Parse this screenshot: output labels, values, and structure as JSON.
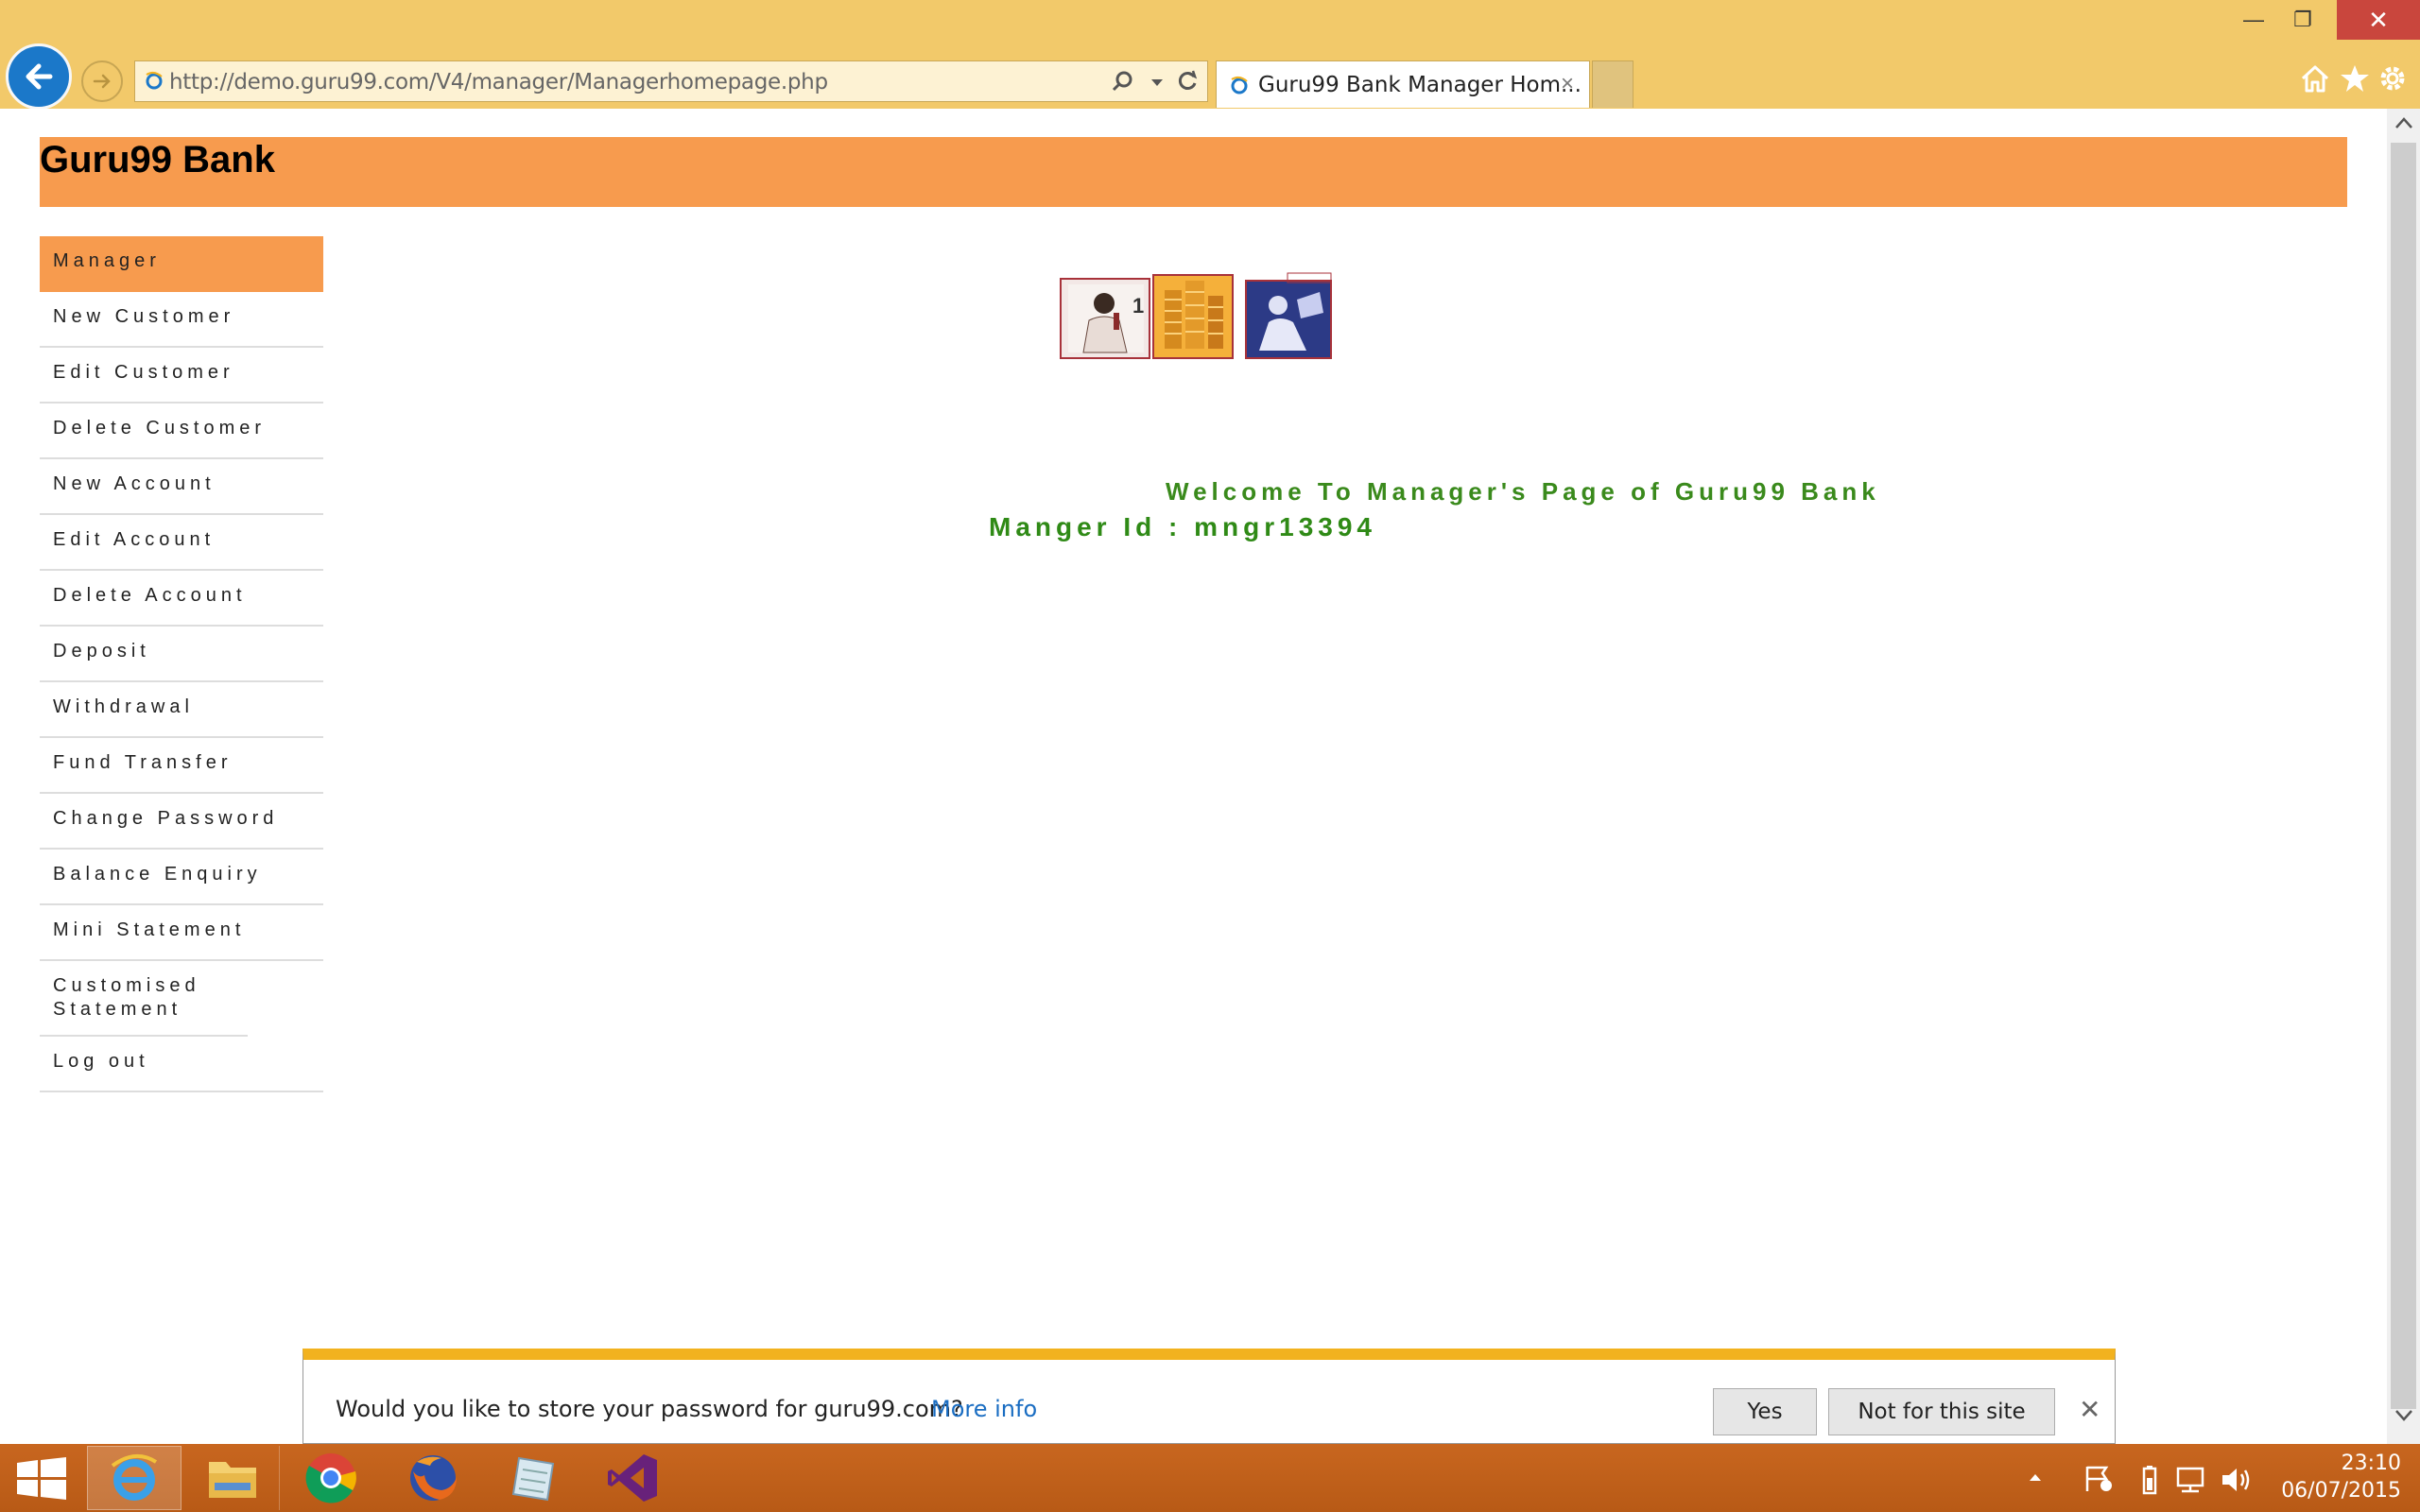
{
  "browser": {
    "address_url": "http://demo.guru99.com/V4/manager/Managerhomepage.php",
    "tab_title": "Guru99 Bank Manager Hom...",
    "tab_close_glyph": "×",
    "window_controls": {
      "minimize": "—",
      "restore": "❐",
      "close": "✕"
    }
  },
  "site": {
    "title": "Guru99 Bank",
    "welcome_text": "Welcome To Manager's Page of Guru99 Bank",
    "manager_id_text": "Manger Id : mngr13394"
  },
  "menu": {
    "items": [
      {
        "label": "Manager",
        "active": true
      },
      {
        "label": "New Customer"
      },
      {
        "label": "Edit Customer"
      },
      {
        "label": "Delete Customer"
      },
      {
        "label": "New Account"
      },
      {
        "label": "Edit Account"
      },
      {
        "label": "Delete Account"
      },
      {
        "label": "Deposit"
      },
      {
        "label": "Withdrawal"
      },
      {
        "label": "Fund Transfer"
      },
      {
        "label": "Change Password"
      },
      {
        "label": "Balance Enquiry"
      },
      {
        "label": "Mini Statement"
      },
      {
        "label": "Customised Statement"
      },
      {
        "label": "Log out"
      }
    ]
  },
  "notification": {
    "message": "Would you like to store your password for guru99.com?",
    "more_info": "More info",
    "yes": "Yes",
    "not_for_site": "Not for this site",
    "close_glyph": "✕"
  },
  "taskbar": {
    "time": "23:10",
    "date": "06/07/2015",
    "apps": [
      "internet-explorer",
      "file-explorer",
      "chrome",
      "firefox",
      "notes",
      "visual-studio"
    ]
  },
  "colors": {
    "chrome_bg": "#f2c96a",
    "header_orange": "#f79b4e",
    "welcome_green": "#3a8a1c",
    "taskbar_orange": "#c8661f",
    "notif_accent": "#f2b21f"
  }
}
